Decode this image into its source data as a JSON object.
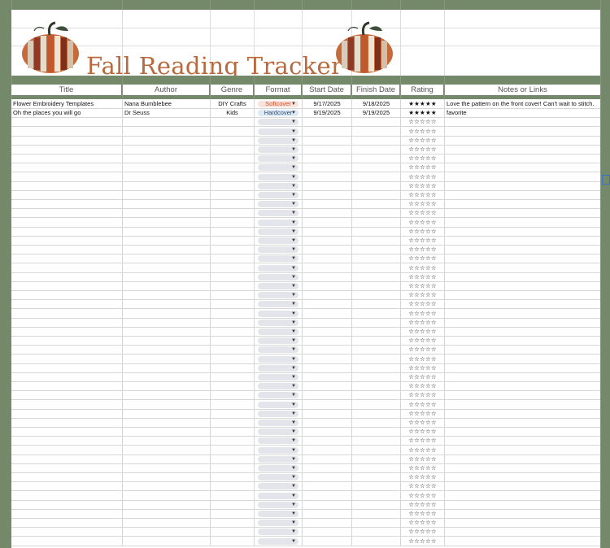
{
  "title": "Fall Reading Tracker",
  "columns": [
    "Title",
    "Author",
    "Genre",
    "Format",
    "Start Date",
    "Finish Date",
    "Rating",
    "Notes or Links"
  ],
  "colors": {
    "page_background": "#74896a",
    "title_color": "#b86a3e",
    "softcover_chip": "#fbe3dc",
    "softcover_text": "#c8502d",
    "hardcover_chip": "#dde9f6",
    "hardcover_text": "#2d4e7a",
    "empty_chip": "#e3e5ea"
  },
  "rows": [
    {
      "title": "Flower Embroidery Templates",
      "author": "Nana Bumblebee",
      "genre": "DIY Crafts",
      "format": "Softcover",
      "start": "9/17/2025",
      "finish": "9/18/2025",
      "rating": "★★★★★",
      "notes": "Love the pattern on the front cover! Can't wait to stitch."
    },
    {
      "title": "Oh the places you will go",
      "author": "Dr Seuss",
      "genre": "Kids",
      "format": "Hardcover",
      "start": "9/19/2025",
      "finish": "9/19/2025",
      "rating": "★★★★★",
      "notes": "favorite"
    }
  ],
  "empty_rating": "☆☆☆☆☆",
  "empty_row_count": 47
}
